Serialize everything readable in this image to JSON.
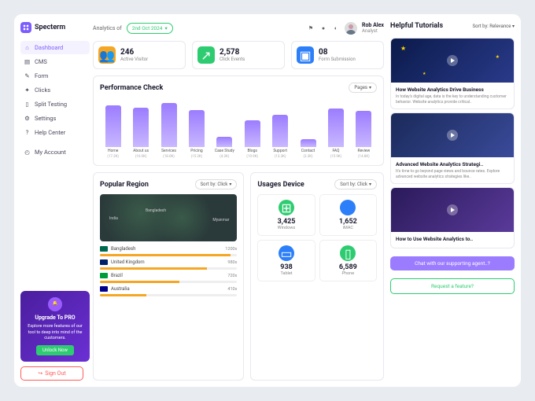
{
  "brand": "Specterm",
  "analytics_label": "Analytics of",
  "date": "2nd Oct 2024",
  "user": {
    "name": "Rob Alex",
    "role": "Analyst"
  },
  "nav": [
    {
      "label": "Dashboard",
      "icon": "home-icon",
      "active": true
    },
    {
      "label": "CMS",
      "icon": "cms-icon"
    },
    {
      "label": "Form",
      "icon": "form-icon"
    },
    {
      "label": "Clicks",
      "icon": "clicks-icon"
    },
    {
      "label": "Split Testing",
      "icon": "split-icon"
    },
    {
      "label": "Settings",
      "icon": "settings-icon"
    },
    {
      "label": "Help Center",
      "icon": "help-icon"
    }
  ],
  "nav_account": {
    "label": "My Account",
    "icon": "account-icon"
  },
  "promo": {
    "title": "Upgrade To PRO",
    "desc": "Explore more features of our tool to deep into mind of the customers.",
    "cta": "Unlock Now"
  },
  "signout": "Sign Out",
  "stats": [
    {
      "value": "246",
      "label": "Active Visitor"
    },
    {
      "value": "2,578",
      "label": "Click Events"
    },
    {
      "value": "08",
      "label": "Form Submission"
    }
  ],
  "chart_title": "Performance Check",
  "chart_filter": "Pages",
  "chart_data": {
    "type": "bar",
    "title": "Performance Check",
    "ylim": [
      0,
      20000
    ],
    "categories": [
      "Home",
      "About us",
      "Services",
      "Pricing",
      "Case Study",
      "Blogs",
      "Support",
      "Contact",
      "FAQ",
      "Review"
    ],
    "values": [
      17200,
      16000,
      18000,
      15200,
      4200,
      10900,
      13300,
      3300,
      15900,
      14800
    ],
    "value_labels": [
      "(17.2K)",
      "(16.0K)",
      "(18.0K)",
      "(15.2K)",
      "(4.2K)",
      "(10.9K)",
      "(13.3K)",
      "(3.3K)",
      "(15.9K)",
      "(14.8K)"
    ]
  },
  "region": {
    "title": "Popular Region",
    "sort": "Sort by: Click",
    "map_labels": [
      "India",
      "Bangladesh",
      "Myanmar"
    ],
    "rows": [
      {
        "name": "Bangladesh",
        "val": "1200x",
        "pct": 95,
        "flag": "#006a4e"
      },
      {
        "name": "United Kingdom",
        "val": "980x",
        "pct": 78,
        "flag": "#012169"
      },
      {
        "name": "Brazil",
        "val": "720x",
        "pct": 58,
        "flag": "#009c3b"
      },
      {
        "name": "Australia",
        "val": "410x",
        "pct": 34,
        "flag": "#00008b"
      }
    ]
  },
  "devices": {
    "title": "Usages Device",
    "sort": "Sort by: Click",
    "items": [
      {
        "value": "3,425",
        "label": "Windows",
        "color": "g",
        "icon": "windows-icon"
      },
      {
        "value": "1,652",
        "label": "iMAC",
        "color": "b",
        "icon": "apple-icon"
      },
      {
        "value": "938",
        "label": "Tablet",
        "color": "b",
        "icon": "tablet-icon"
      },
      {
        "value": "6,589",
        "label": "Phone",
        "color": "g",
        "icon": "phone-icon"
      }
    ]
  },
  "tutorials": {
    "title": "Helpful Tutorials",
    "sort": "Sort by: Relevance",
    "items": [
      {
        "title": "How Website Analytics Drive Business",
        "desc": "In today's digital age, data is the key to understanding customer behavior. Website analytics provide critical.."
      },
      {
        "title": "Advanced Website Analytics Strategi..",
        "desc": "It's time to go beyond page views and bounce rates. Explore advanced website analytics strategies like.."
      },
      {
        "title": "How to Use Website Analytics to..",
        "desc": ""
      }
    ]
  },
  "chat_btn": "Chat with our supporting agent..?",
  "request_btn": "Request a feature?"
}
